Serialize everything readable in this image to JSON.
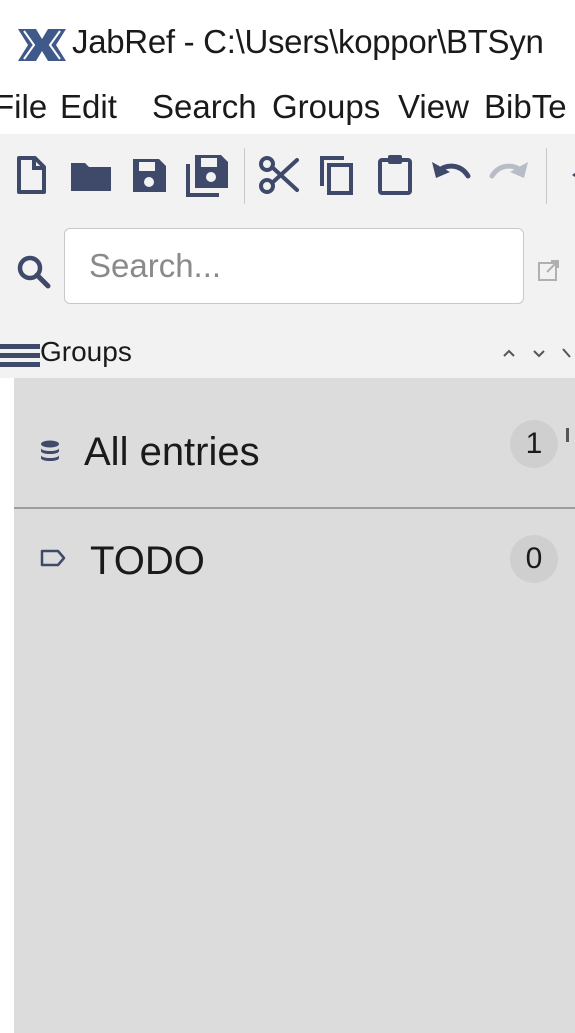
{
  "window": {
    "title": "JabRef - C:\\Users\\koppor\\BTSyn"
  },
  "menubar": {
    "items": [
      "File",
      "Edit",
      "Search",
      "Groups",
      "View",
      "BibTe"
    ]
  },
  "toolbar": {
    "icons": [
      "new-library-icon",
      "open-library-icon",
      "save-icon",
      "save-all-icon",
      "cut-icon",
      "copy-icon",
      "paste-icon",
      "undo-icon",
      "redo-icon"
    ]
  },
  "search": {
    "placeholder": "Search...",
    "value": ""
  },
  "groups_panel": {
    "title": "Groups",
    "groups": [
      {
        "name": "All entries",
        "count": "1",
        "icon": "database-icon"
      },
      {
        "name": "TODO",
        "count": "0",
        "icon": "tag-icon"
      }
    ]
  },
  "colors": {
    "icon": "#3f4a6b",
    "pane_background": "#dcdcdc",
    "toolbar_background": "#f2f2f2",
    "logo": "#3f5a8a"
  }
}
